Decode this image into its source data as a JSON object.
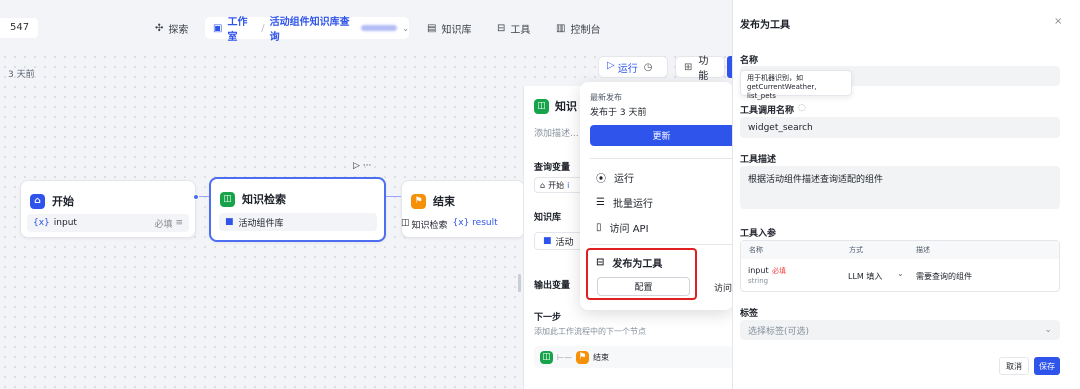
{
  "topbar": {
    "id": "547",
    "explore": "探索",
    "studio": "工作室",
    "breadcrumb_sep": "/",
    "app_name": "活动组件知识库查询",
    "knowledge": "知识库",
    "tools": "工具",
    "console": "控制台"
  },
  "canvas": {
    "updated": "3 天前",
    "run": "运行",
    "features": "功能"
  },
  "nodes": {
    "start": {
      "title": "开始",
      "var_icon": "{x}",
      "var": "input",
      "required": "必填"
    },
    "kr": {
      "title": "知识检索",
      "dataset": "活动组件库",
      "actions": "▷ ···"
    },
    "end": {
      "title": "结束",
      "out_node": "知识检索",
      "out_var": "{x} result"
    }
  },
  "side_panel": {
    "title": "知识",
    "desc_placeholder": "添加描述...",
    "query_var": "查询变量",
    "query_src_node": "开始",
    "query_src_var": "i",
    "kb": "知识库",
    "kb_item": "活动",
    "output": "输出变量",
    "next": "下一步",
    "next_desc": "添加此工作流程中的下一个节点",
    "next_end": "结束"
  },
  "publish_menu": {
    "latest": "最新发布",
    "published": "发布于 3 天前",
    "update": "更新",
    "run": "运行",
    "batch_run": "批量运行",
    "access_api": "访问 API",
    "publish_tool": "发布为工具",
    "configure": "配置",
    "visit": "访问"
  },
  "tool_panel": {
    "title": "发布为工具",
    "close": "×",
    "name_label": "名称",
    "name_tooltip_1": "用于机器识别，如",
    "name_tooltip_2": "getCurrentWeather, list_pets",
    "call_name_label": "工具调用名称",
    "call_name_value": "widget_search",
    "desc_label": "工具描述",
    "desc_value": "根据活动组件描述查询适配的组件",
    "params_label": "工具入参",
    "param_headers": [
      "名称",
      "方式",
      "描述"
    ],
    "params": [
      {
        "name": "input",
        "required": "必填",
        "type": "string",
        "method": "LLM 填入",
        "desc": "需要查询的组件"
      }
    ],
    "tags_label": "标签",
    "tags_placeholder": "选择标签(可选)",
    "cancel": "取消",
    "save": "保存"
  },
  "colors": {
    "accent": "#2f54eb",
    "green": "#16a34a",
    "orange": "#f79009",
    "highlight": "#e02020"
  }
}
